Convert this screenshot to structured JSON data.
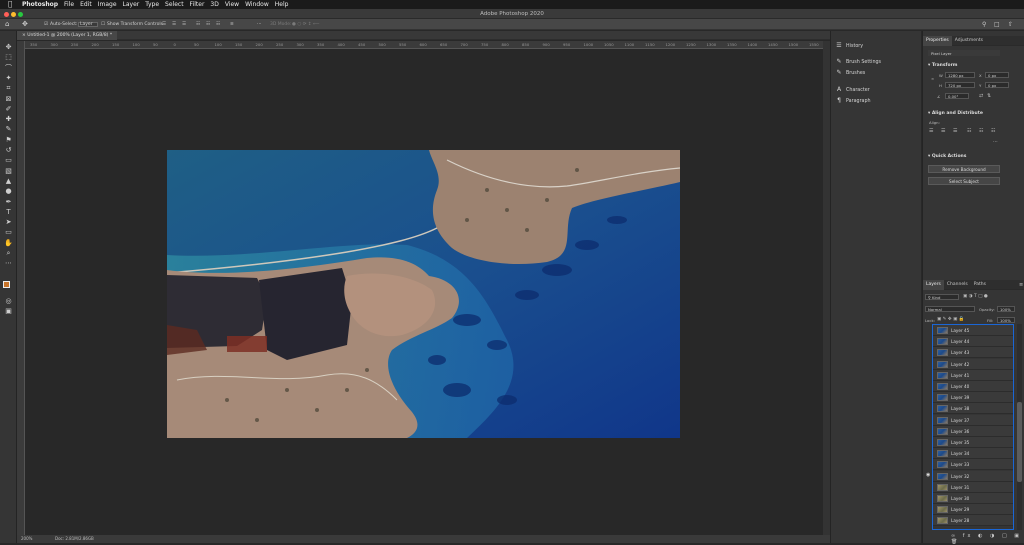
{
  "menubar": {
    "apple": "",
    "menus": [
      "Photoshop",
      "File",
      "Edit",
      "Image",
      "Layer",
      "Type",
      "Select",
      "Filter",
      "3D",
      "View",
      "Window",
      "Help"
    ]
  },
  "titlebar": {
    "title": "Adobe Photoshop 2020"
  },
  "options": {
    "auto_select": "Auto-Select:",
    "layer_dropdown": "Layer",
    "show_transform": "Show Transform Controls",
    "three_d_mode": "3D Mode:"
  },
  "document_tab": {
    "label": "Untitled-1 @ 200% (Layer 1, RGB/8) *"
  },
  "ruler_ticks": [
    "350",
    "300",
    "250",
    "200",
    "150",
    "100",
    "50",
    "0",
    "50",
    "100",
    "150",
    "200",
    "250",
    "300",
    "350",
    "400",
    "450",
    "500",
    "550",
    "600",
    "650",
    "700",
    "750",
    "800",
    "850",
    "900",
    "950",
    "1000",
    "1050",
    "1100",
    "1150",
    "1200",
    "1250",
    "1300",
    "1350",
    "1400",
    "1450",
    "1500",
    "1550",
    "1600"
  ],
  "statusbar": {
    "zoom": "200%",
    "doc": "Doc: 2.81M/2.86GB"
  },
  "dock": {
    "history": "History",
    "brush_settings": "Brush Settings",
    "brushes": "Brushes",
    "character": "Character",
    "paragraph": "Paragraph"
  },
  "properties": {
    "tabs": [
      "Properties",
      "Adjustments"
    ],
    "kind": "Pixel Layer",
    "transform_title": "Transform",
    "w_label": "W",
    "w_value": "1280 px",
    "h_label": "H",
    "h_value": "720 px",
    "x_label": "X",
    "x_value": "0 px",
    "y_label": "Y",
    "y_value": "0 px",
    "angle_value": "0.00°",
    "align_title": "Align and Distribute",
    "align_label": "Align:",
    "quick_title": "Quick Actions",
    "remove_bg": "Remove Background",
    "select_subject": "Select Subject"
  },
  "layers_panel": {
    "tabs": [
      "Layers",
      "Channels",
      "Paths"
    ],
    "filter": "Kind",
    "blend_mode": "Normal",
    "opacity_label": "Opacity:",
    "opacity_value": "100%",
    "lock_label": "Lock:",
    "fill_label": "Fill:",
    "fill_value": "100%",
    "layers": [
      {
        "name": "Layer 45",
        "thumb": "blue",
        "visible": false
      },
      {
        "name": "Layer 44",
        "thumb": "blue",
        "visible": false
      },
      {
        "name": "Layer 43",
        "thumb": "blue",
        "visible": false
      },
      {
        "name": "Layer 42",
        "thumb": "blue",
        "visible": false
      },
      {
        "name": "Layer 41",
        "thumb": "blue",
        "visible": false
      },
      {
        "name": "Layer 40",
        "thumb": "blue",
        "visible": false
      },
      {
        "name": "Layer 39",
        "thumb": "blue",
        "visible": false
      },
      {
        "name": "Layer 38",
        "thumb": "blue",
        "visible": false
      },
      {
        "name": "Layer 37",
        "thumb": "blue",
        "visible": false
      },
      {
        "name": "Layer 36",
        "thumb": "blue",
        "visible": false
      },
      {
        "name": "Layer 35",
        "thumb": "blue",
        "visible": false
      },
      {
        "name": "Layer 34",
        "thumb": "blue",
        "visible": false
      },
      {
        "name": "Layer 33",
        "thumb": "blue",
        "visible": false
      },
      {
        "name": "Layer 32",
        "thumb": "blue",
        "visible": true
      },
      {
        "name": "Layer 31",
        "thumb": "beige",
        "visible": false
      },
      {
        "name": "Layer 30",
        "thumb": "beige",
        "visible": false
      },
      {
        "name": "Layer 29",
        "thumb": "beige",
        "visible": false
      },
      {
        "name": "Layer 28",
        "thumb": "beige",
        "visible": false
      }
    ]
  },
  "colors": {
    "foreground": "#c8742a",
    "background": "#ffffff",
    "selection_outline": "#1a66d6"
  }
}
